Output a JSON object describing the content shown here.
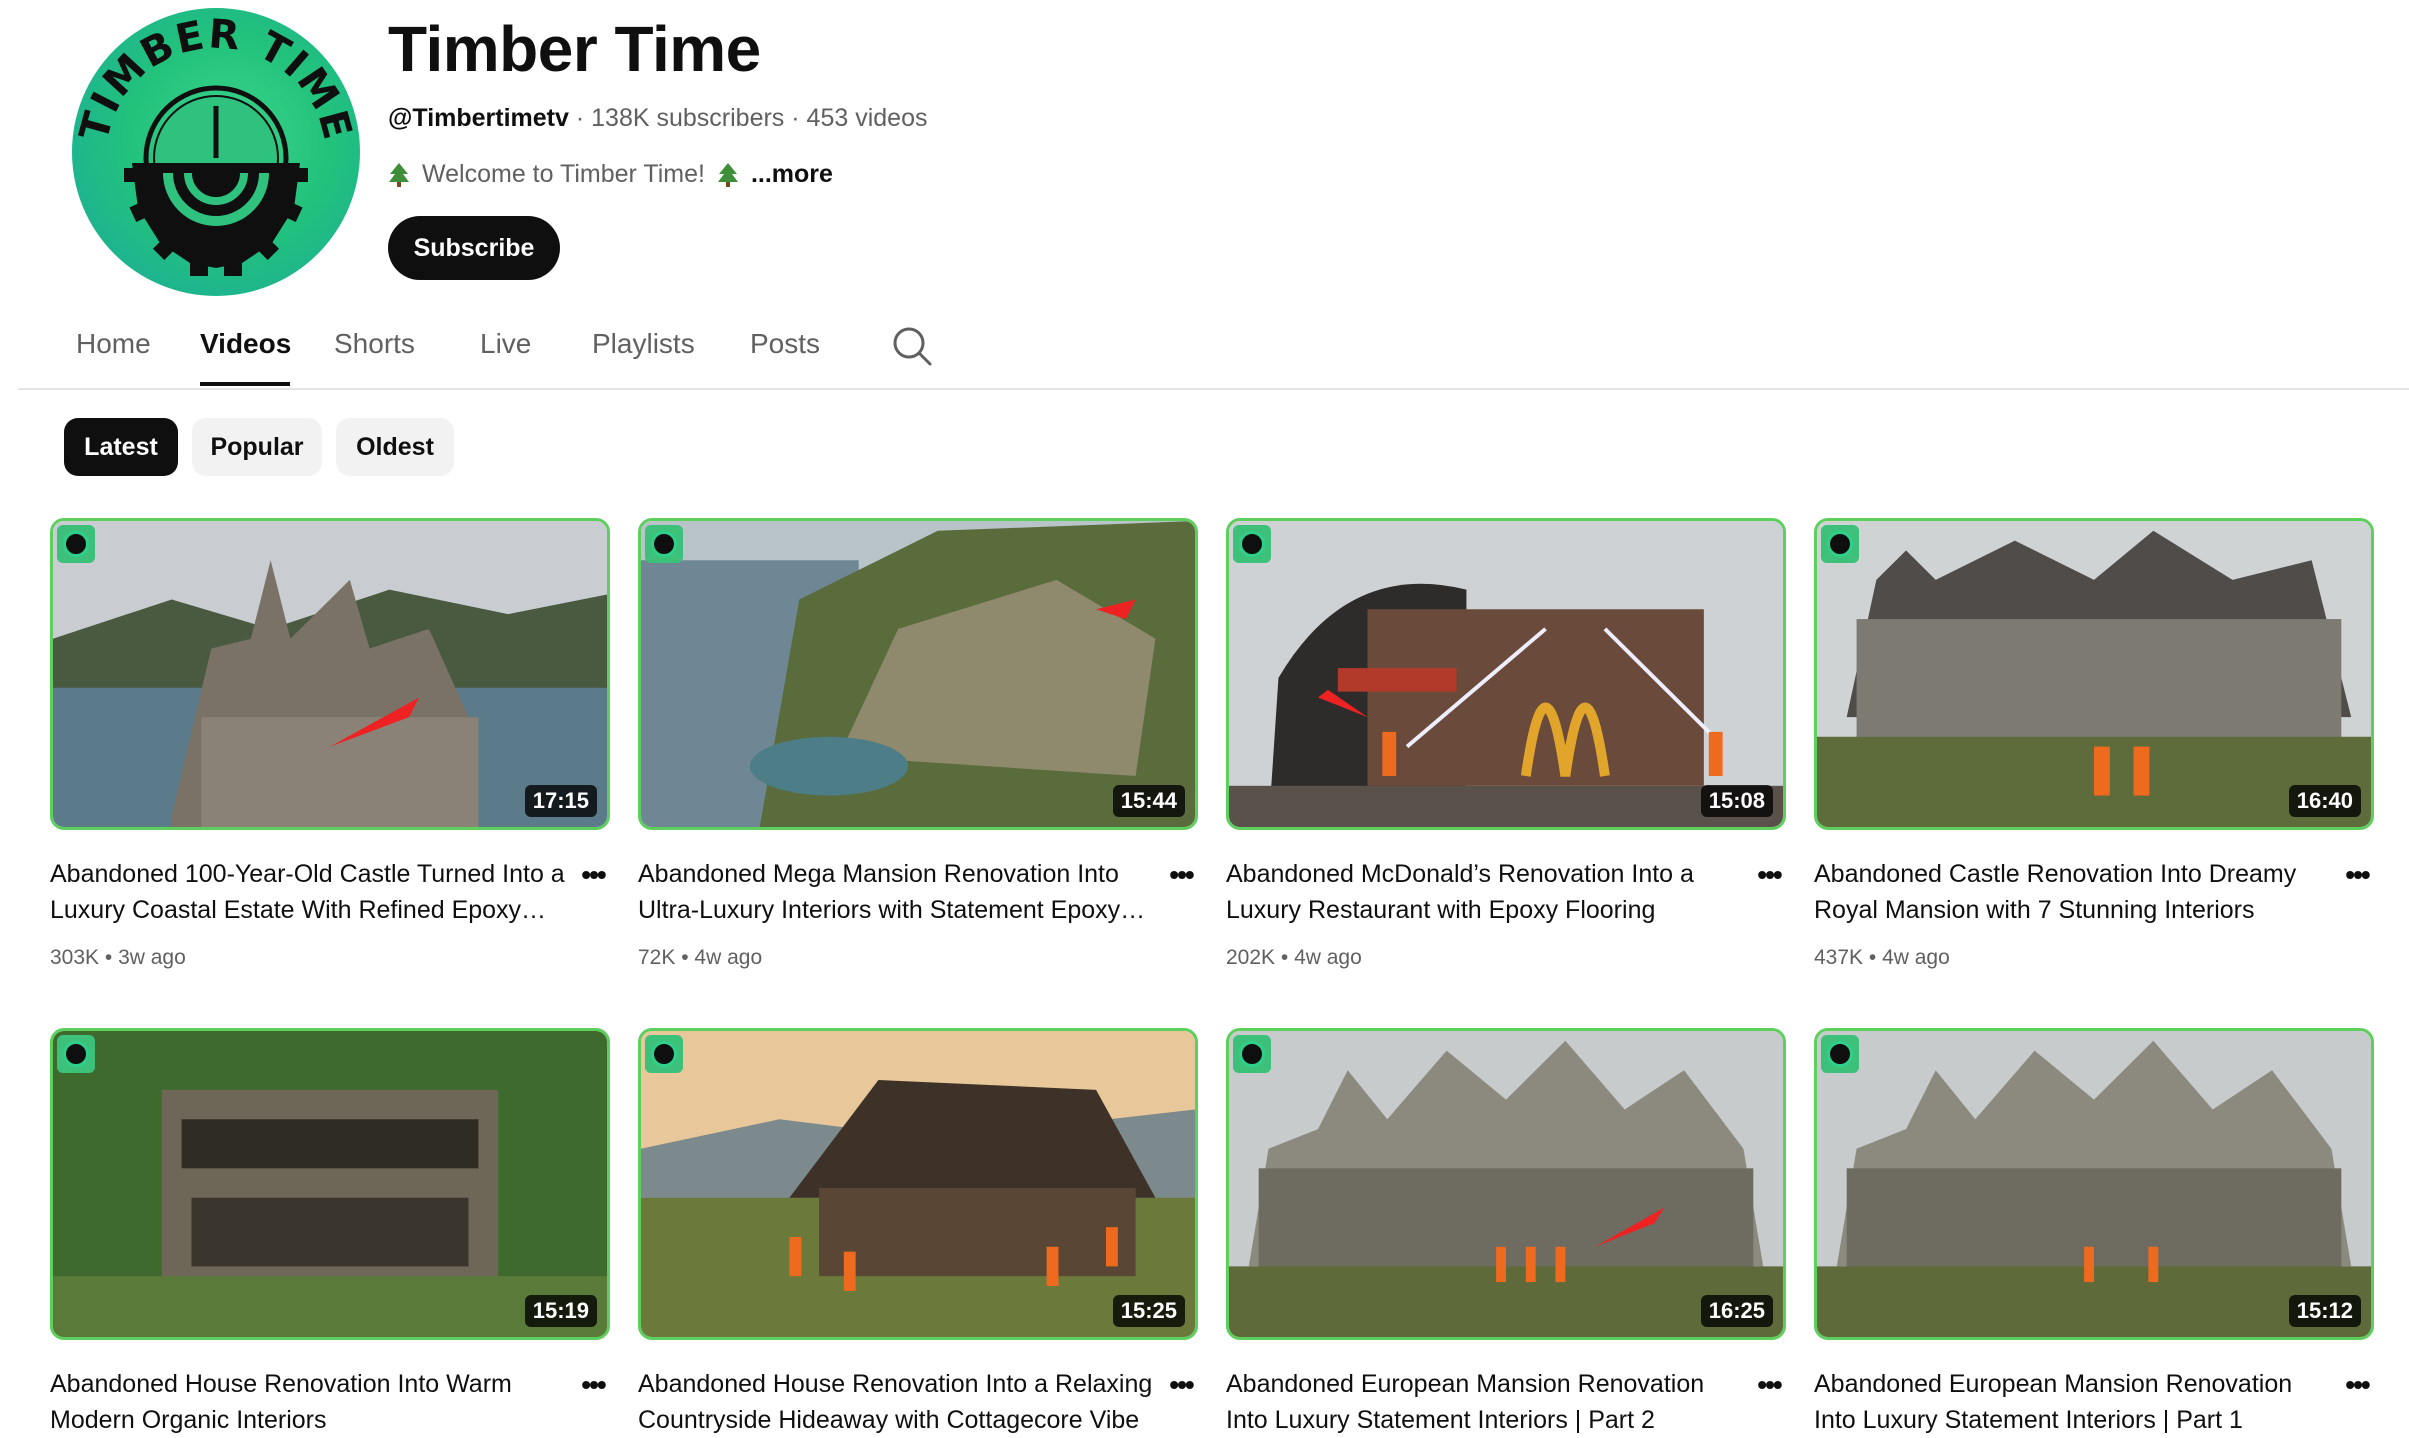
{
  "channel": {
    "title": "Timber Time",
    "handle": "@Timbertimetv",
    "subscribers": "138K subscribers",
    "videos": "453 videos",
    "description": "Welcome to Timber Time!",
    "more": "...more",
    "subscribe_label": "Subscribe",
    "avatar_text": "TIMBER TIME",
    "accent": "#2fc27f"
  },
  "tabs": [
    {
      "label": "Home"
    },
    {
      "label": "Videos"
    },
    {
      "label": "Shorts"
    },
    {
      "label": "Live"
    },
    {
      "label": "Playlists"
    },
    {
      "label": "Posts"
    }
  ],
  "active_tab": "Videos",
  "chips": [
    {
      "label": "Latest"
    },
    {
      "label": "Popular"
    },
    {
      "label": "Oldest"
    }
  ],
  "active_chip": "Latest",
  "videos": [
    {
      "title": "Abandoned 100-Year-Old Castle Turned Into a Luxury Coastal Estate With Refined Epoxy…",
      "duration": "17:15",
      "views": "303K",
      "age": "3w ago"
    },
    {
      "title": "Abandoned Mega Mansion Renovation Into Ultra-Luxury Interiors with Statement Epoxy…",
      "duration": "15:44",
      "views": "72K",
      "age": "4w ago"
    },
    {
      "title": "Abandoned McDonald’s Renovation Into a Luxury Restaurant with Epoxy Flooring",
      "duration": "15:08",
      "views": "202K",
      "age": "4w ago"
    },
    {
      "title": "Abandoned Castle Renovation Into Dreamy Royal Mansion with 7 Stunning Interiors",
      "duration": "16:40",
      "views": "437K",
      "age": "4w ago"
    },
    {
      "title": "Abandoned House Renovation Into Warm Modern Organic Interiors",
      "duration": "15:19",
      "views": "",
      "age": ""
    },
    {
      "title": "Abandoned House Renovation Into a Relaxing Countryside Hideaway with Cottagecore Vibe",
      "duration": "15:25",
      "views": "",
      "age": ""
    },
    {
      "title": "Abandoned European Mansion Renovation Into Luxury Statement Interiors | Part 2",
      "duration": "16:25",
      "views": "",
      "age": ""
    },
    {
      "title": "Abandoned European Mansion Renovation Into Luxury Statement Interiors | Part 1",
      "duration": "15:12",
      "views": "",
      "age": ""
    }
  ]
}
